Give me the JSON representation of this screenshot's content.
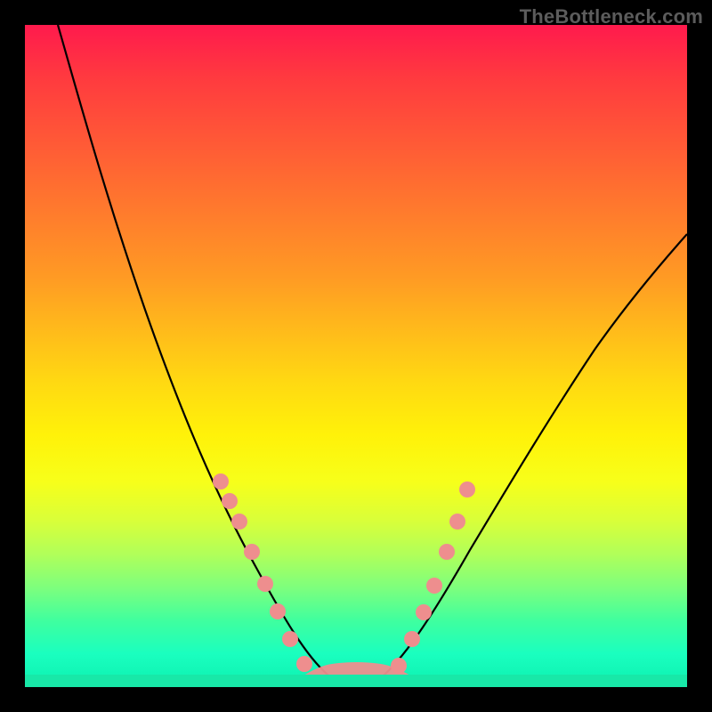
{
  "watermark": "TheBottleneck.com",
  "chart_data": {
    "type": "line",
    "title": "",
    "xlabel": "",
    "ylabel": "",
    "xlim": [
      0,
      100
    ],
    "ylim": [
      0,
      100
    ],
    "grid": false,
    "legend": false,
    "series": [
      {
        "name": "bottleneck-curve",
        "color": "#000000",
        "x": [
          5,
          10,
          15,
          20,
          25,
          30,
          35,
          38,
          40,
          42,
          44,
          46,
          48,
          50,
          52,
          55,
          58,
          62,
          66,
          70,
          75,
          80,
          85,
          90,
          95,
          100
        ],
        "y": [
          100,
          90,
          78,
          65,
          52,
          40,
          28,
          20,
          14,
          9,
          5,
          2,
          0.5,
          0,
          0.5,
          2,
          5,
          10,
          16,
          23,
          31,
          39,
          46,
          53,
          59,
          64
        ]
      },
      {
        "name": "left-dots",
        "color": "#f08080",
        "type": "scatter",
        "x": [
          29,
          30.5,
          32,
          34,
          36,
          38,
          40,
          42.5
        ],
        "y": [
          31,
          28,
          25,
          20,
          15,
          11,
          7,
          3
        ]
      },
      {
        "name": "right-dots",
        "color": "#f08080",
        "type": "scatter",
        "x": [
          56,
          58,
          59.5,
          61,
          63,
          64.5,
          66
        ],
        "y": [
          3,
          7,
          11,
          15,
          20,
          25,
          30
        ]
      },
      {
        "name": "bottom-band",
        "color": "#f08080",
        "type": "area",
        "x": [
          42,
          44,
          46,
          48,
          50,
          52,
          54,
          56
        ],
        "y": [
          2,
          1,
          0.5,
          0.2,
          0.2,
          0.5,
          1,
          2
        ]
      }
    ],
    "background_gradient": {
      "top": "#ff1a4d",
      "mid": "#ffe000",
      "bottom": "#18e8a8"
    }
  }
}
